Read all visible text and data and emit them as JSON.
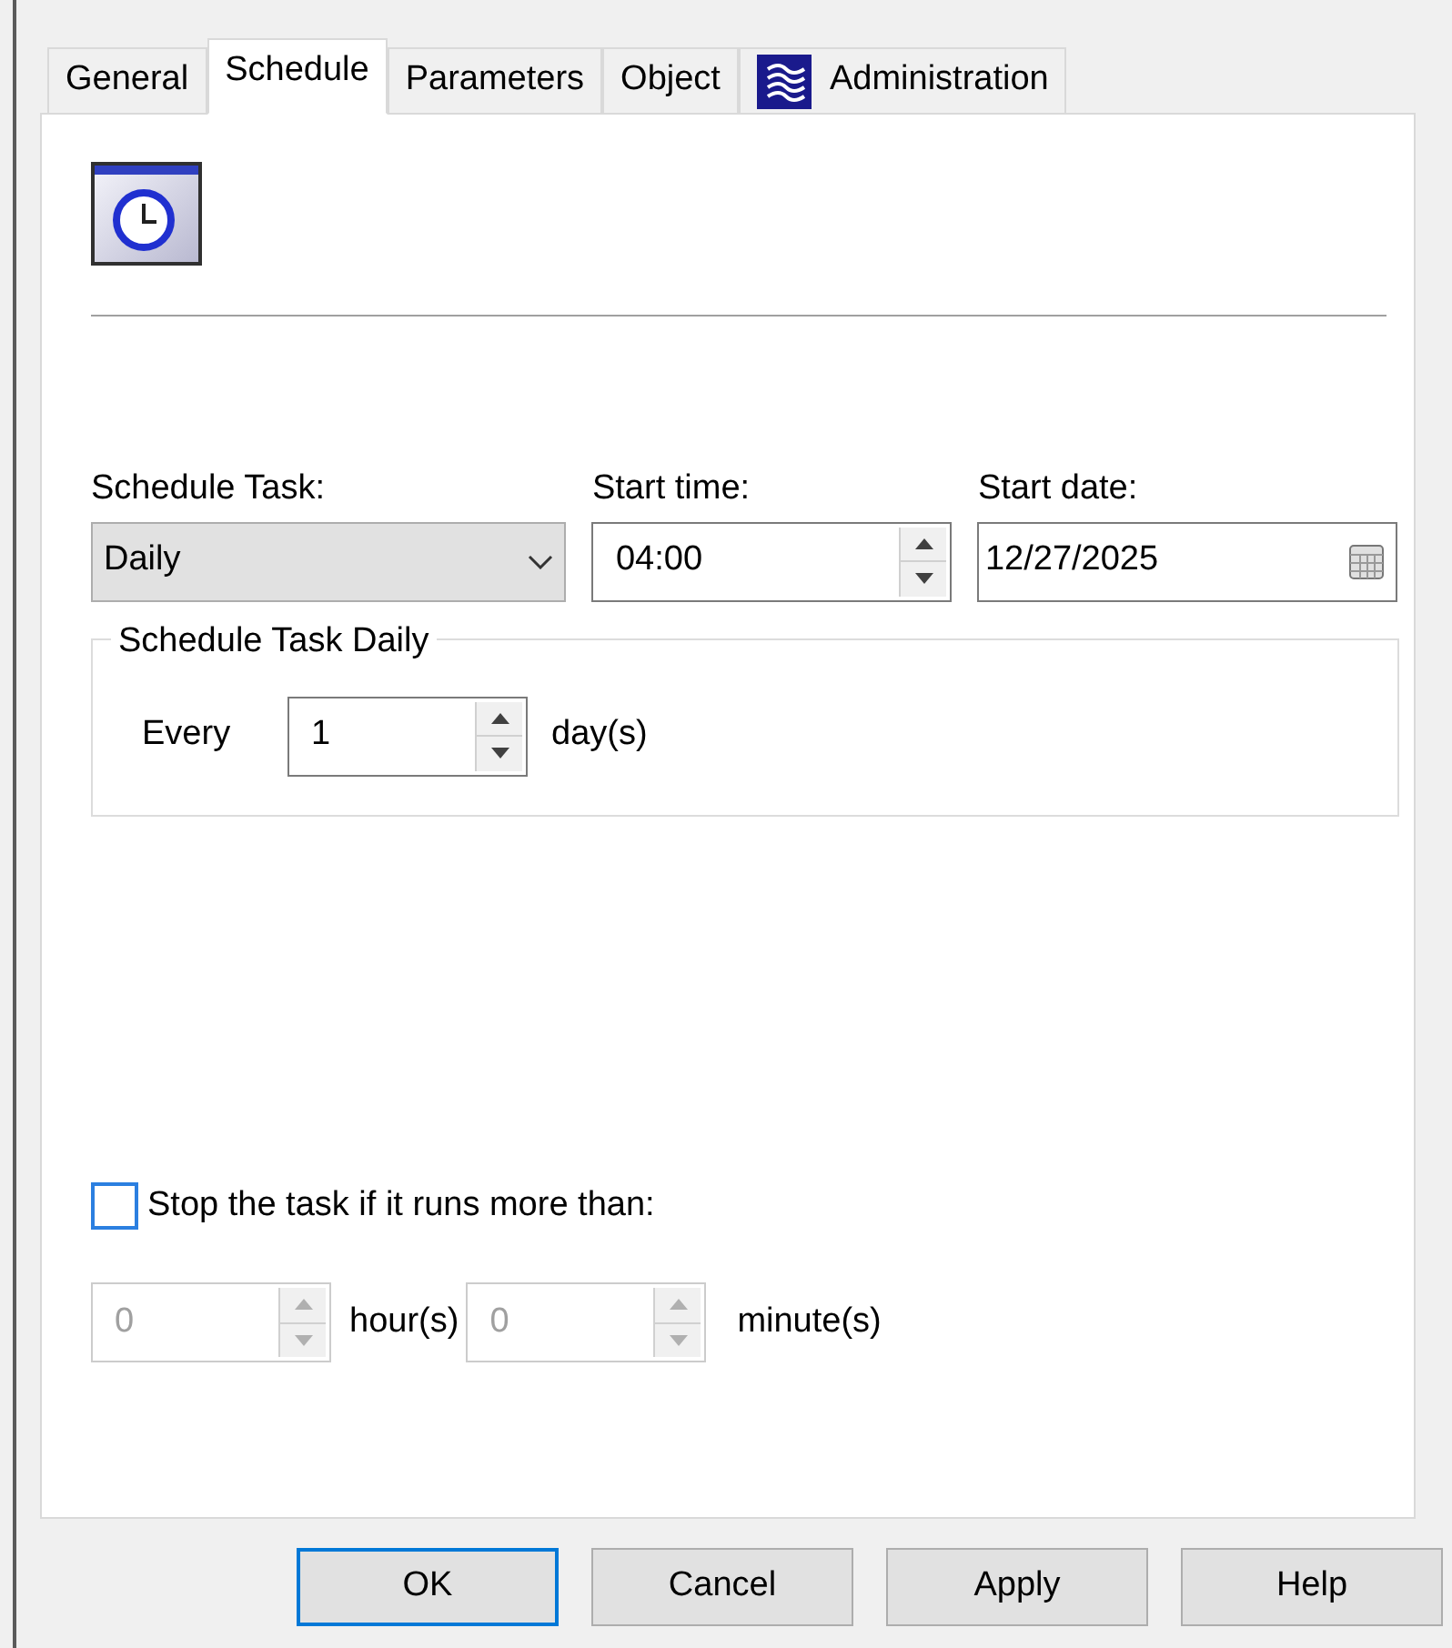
{
  "tabs": [
    {
      "label": "General",
      "selected": false,
      "kind": "text"
    },
    {
      "label": "Schedule",
      "selected": true,
      "kind": "text"
    },
    {
      "label": "Parameters",
      "selected": false,
      "kind": "text"
    },
    {
      "label": "Object",
      "selected": false,
      "kind": "text"
    },
    {
      "label": "Administration",
      "selected": false,
      "kind": "icon"
    }
  ],
  "schedule_task": {
    "label": "Schedule Task:",
    "value": "Daily"
  },
  "start_time": {
    "label": "Start time:",
    "value": "04:00"
  },
  "start_date": {
    "label": "Start date:",
    "value": "12/27/2025"
  },
  "daily_group": {
    "title": "Schedule Task Daily",
    "every_label": "Every",
    "value": "1",
    "unit": "day(s)"
  },
  "stop_task": {
    "label": "Stop the task if it runs more than:",
    "checked": false
  },
  "duration": [
    {
      "value": "0",
      "unit": "hour(s)",
      "disabled": true
    },
    {
      "value": "0",
      "unit": "minute(s)",
      "disabled": true
    }
  ],
  "buttons": [
    {
      "label": "OK",
      "default": true
    },
    {
      "label": "Cancel",
      "default": false
    },
    {
      "label": "Apply",
      "default": false
    },
    {
      "label": "Help",
      "default": false
    }
  ]
}
